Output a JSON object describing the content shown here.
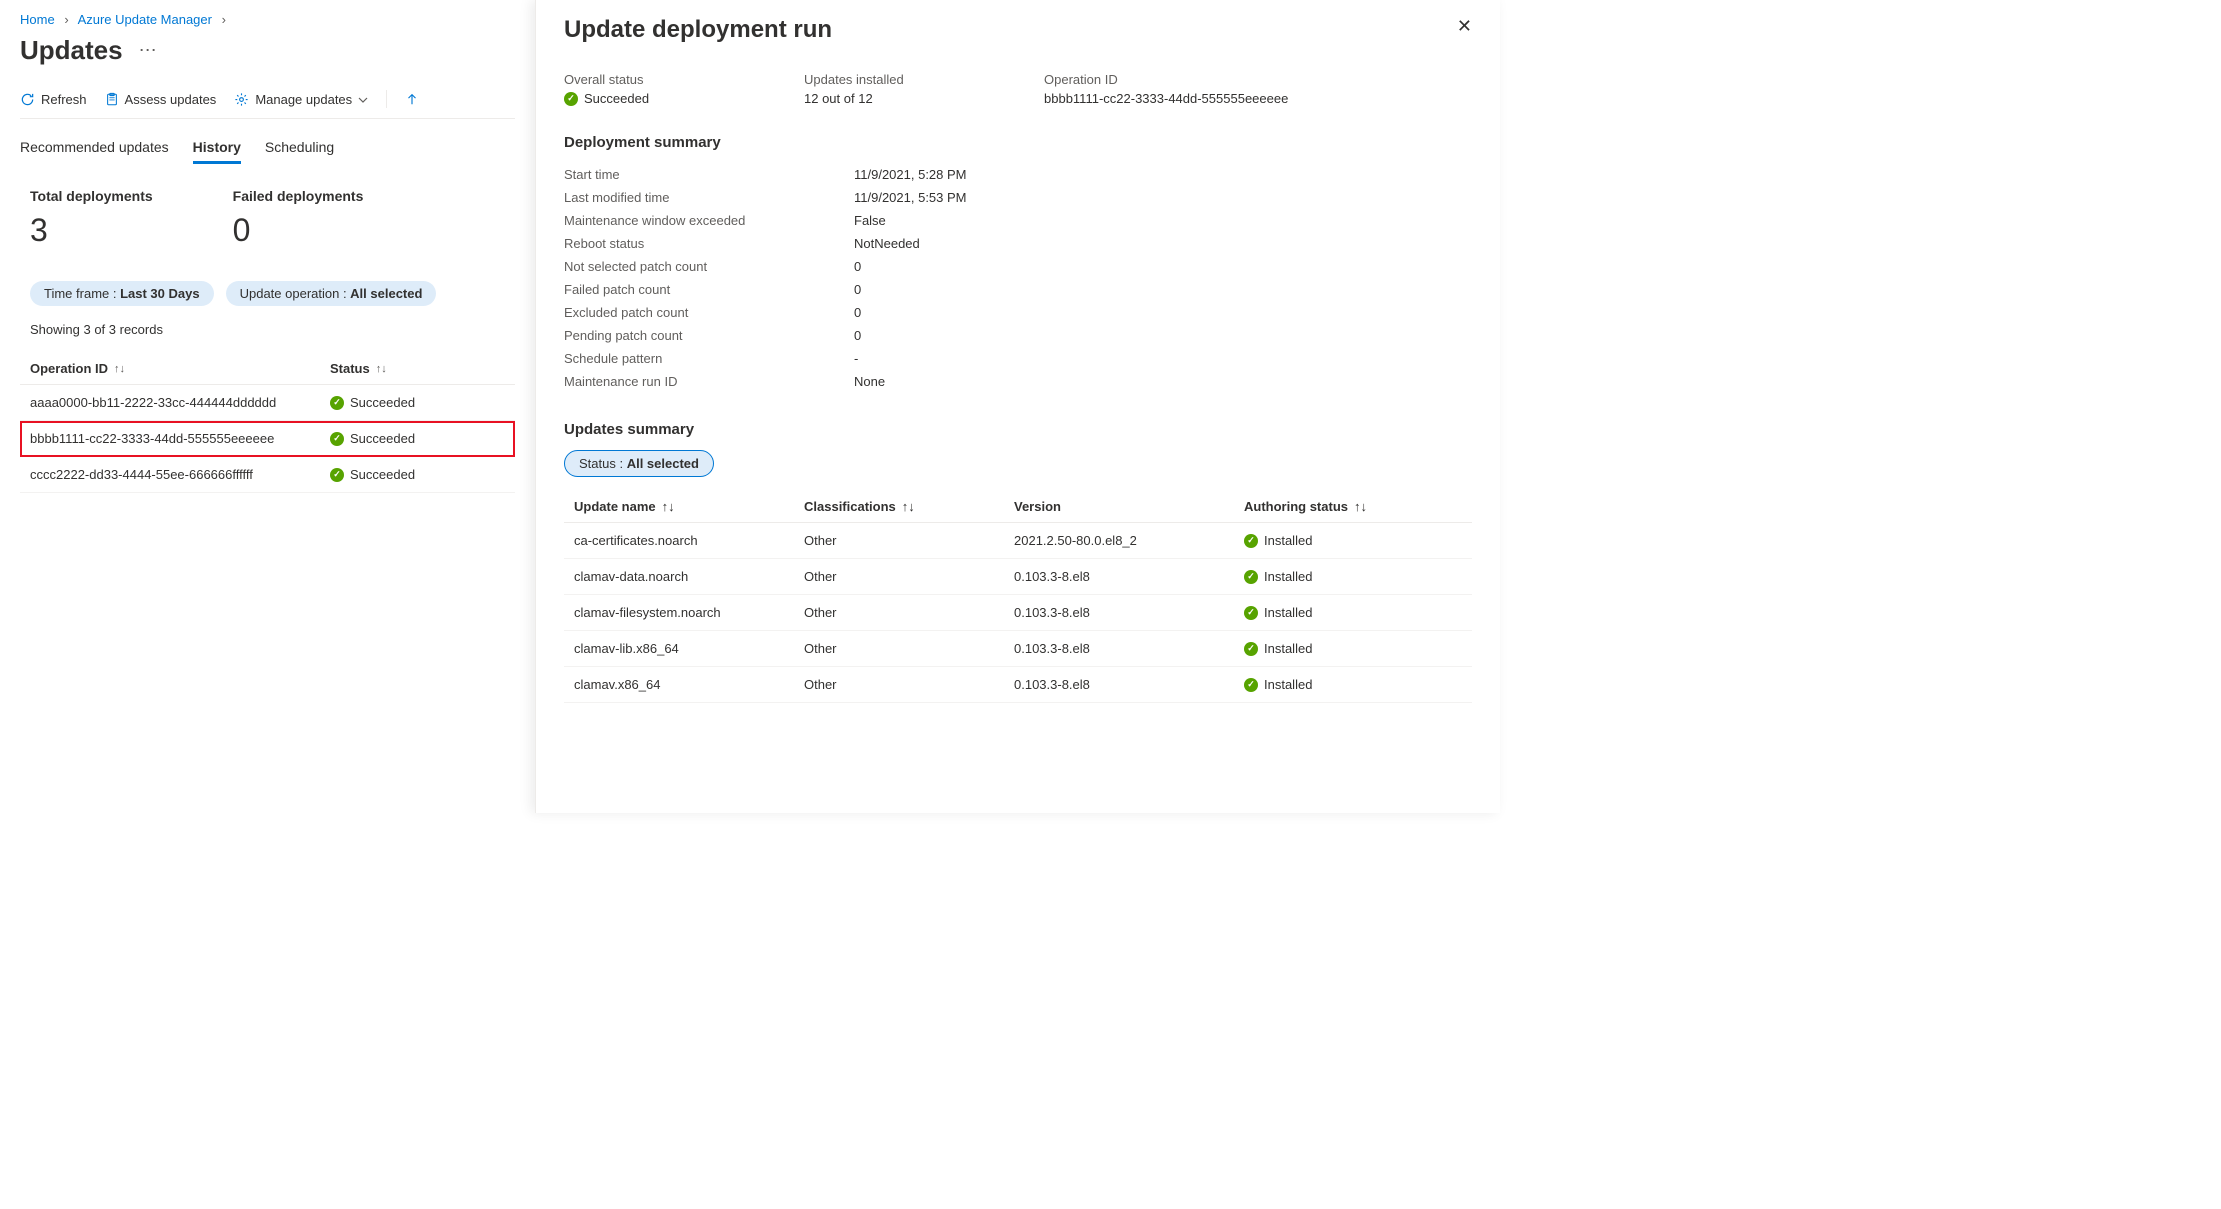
{
  "breadcrumb": {
    "home": "Home",
    "parent": "Azure Update Manager"
  },
  "page_title": "Updates",
  "toolbar": {
    "refresh": "Refresh",
    "assess": "Assess updates",
    "manage": "Manage updates"
  },
  "tabs": {
    "recommended": "Recommended updates",
    "history": "History",
    "scheduling": "Scheduling"
  },
  "stats": {
    "total_label": "Total deployments",
    "total_value": "3",
    "failed_label": "Failed deployments",
    "failed_value": "0"
  },
  "filters": {
    "timeframe_label": "Time frame : ",
    "timeframe_value": "Last 30 Days",
    "operation_label": "Update operation : ",
    "operation_value": "All selected"
  },
  "records_text": "Showing 3 of 3 records",
  "table": {
    "col_operation": "Operation ID",
    "col_status": "Status",
    "rows": [
      {
        "id": "aaaa0000-bb11-2222-33cc-444444dddddd",
        "status": "Succeeded"
      },
      {
        "id": "bbbb1111-cc22-3333-44dd-555555eeeeee",
        "status": "Succeeded"
      },
      {
        "id": "cccc2222-dd33-4444-55ee-666666ffffff",
        "status": "Succeeded"
      }
    ]
  },
  "panel": {
    "title": "Update deployment run",
    "overview": {
      "overall_status_label": "Overall status",
      "overall_status_value": "Succeeded",
      "updates_installed_label": "Updates installed",
      "updates_installed_value": "12 out of 12",
      "operation_id_label": "Operation ID",
      "operation_id_value": "bbbb1111-cc22-3333-44dd-555555eeeeee"
    },
    "summary_title": "Deployment summary",
    "summary": [
      {
        "k": "Start time",
        "v": "11/9/2021, 5:28 PM"
      },
      {
        "k": "Last modified time",
        "v": "11/9/2021, 5:53 PM"
      },
      {
        "k": "Maintenance window exceeded",
        "v": "False"
      },
      {
        "k": "Reboot status",
        "v": "NotNeeded"
      },
      {
        "k": "Not selected patch count",
        "v": "0"
      },
      {
        "k": "Failed patch count",
        "v": "0"
      },
      {
        "k": "Excluded patch count",
        "v": "0"
      },
      {
        "k": "Pending patch count",
        "v": "0"
      },
      {
        "k": "Schedule pattern",
        "v": "-"
      },
      {
        "k": "Maintenance run ID",
        "v": "None"
      }
    ],
    "updates_title": "Updates summary",
    "status_filter_label": "Status : ",
    "status_filter_value": "All selected",
    "updates_table": {
      "col_name": "Update name",
      "col_class": "Classifications",
      "col_version": "Version",
      "col_auth": "Authoring status",
      "rows": [
        {
          "name": "ca-certificates.noarch",
          "class": "Other",
          "version": "2021.2.50-80.0.el8_2",
          "auth": "Installed"
        },
        {
          "name": "clamav-data.noarch",
          "class": "Other",
          "version": "0.103.3-8.el8",
          "auth": "Installed"
        },
        {
          "name": "clamav-filesystem.noarch",
          "class": "Other",
          "version": "0.103.3-8.el8",
          "auth": "Installed"
        },
        {
          "name": "clamav-lib.x86_64",
          "class": "Other",
          "version": "0.103.3-8.el8",
          "auth": "Installed"
        },
        {
          "name": "clamav.x86_64",
          "class": "Other",
          "version": "0.103.3-8.el8",
          "auth": "Installed"
        }
      ]
    }
  }
}
